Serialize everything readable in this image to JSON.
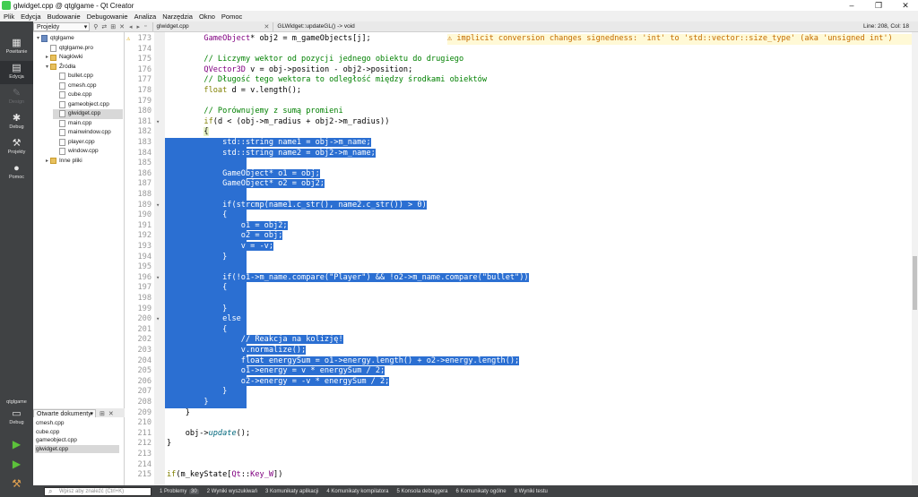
{
  "window": {
    "title": "glwidget.cpp @ qtglgame - Qt Creator",
    "minimize": "–",
    "maximize": "❐",
    "close": "✕"
  },
  "menu": [
    "Plik",
    "Edycja",
    "Budowanie",
    "Debugowanie",
    "Analiza",
    "Narzędzia",
    "Okno",
    "Pomoc"
  ],
  "modes": [
    {
      "label": "Powitanie",
      "icon": "grid-icon"
    },
    {
      "label": "Edycja",
      "icon": "edit-icon"
    },
    {
      "label": "Design",
      "icon": "design-icon"
    },
    {
      "label": "Debug",
      "icon": "bug-icon"
    },
    {
      "label": "Projekty",
      "icon": "wrench-icon"
    },
    {
      "label": "Pomoc",
      "icon": "help-icon"
    }
  ],
  "kit": {
    "project": "qtglgame",
    "config": "Debug"
  },
  "project_pane": {
    "combo": "Projekty",
    "tree": [
      {
        "label": "qtglgame",
        "depth": 0,
        "arrow": "▾",
        "kind": "proj"
      },
      {
        "label": "qtglgame.pro",
        "depth": 1,
        "arrow": "",
        "kind": "file"
      },
      {
        "label": "Nagłówki",
        "depth": 1,
        "arrow": "▸",
        "kind": "folder"
      },
      {
        "label": "Źródła",
        "depth": 1,
        "arrow": "▾",
        "kind": "folder"
      },
      {
        "label": "bullet.cpp",
        "depth": 2,
        "arrow": "",
        "kind": "file"
      },
      {
        "label": "cmesh.cpp",
        "depth": 2,
        "arrow": "",
        "kind": "file"
      },
      {
        "label": "cube.cpp",
        "depth": 2,
        "arrow": "",
        "kind": "file"
      },
      {
        "label": "gameobject.cpp",
        "depth": 2,
        "arrow": "",
        "kind": "file"
      },
      {
        "label": "glwidget.cpp",
        "depth": 2,
        "arrow": "",
        "kind": "file",
        "selected": true
      },
      {
        "label": "main.cpp",
        "depth": 2,
        "arrow": "",
        "kind": "file"
      },
      {
        "label": "mainwindow.cpp",
        "depth": 2,
        "arrow": "",
        "kind": "file"
      },
      {
        "label": "player.cpp",
        "depth": 2,
        "arrow": "",
        "kind": "file"
      },
      {
        "label": "window.cpp",
        "depth": 2,
        "arrow": "",
        "kind": "file"
      },
      {
        "label": "Inne pliki",
        "depth": 1,
        "arrow": "▸",
        "kind": "folder"
      }
    ]
  },
  "open_docs": {
    "combo": "Otwarte dokumenty",
    "items": [
      "cmesh.cpp",
      "cube.cpp",
      "gameobject.cpp",
      "glwidget.cpp"
    ],
    "selected_index": 3
  },
  "editor_toolbar": {
    "file": "glwidget.cpp",
    "symbol": "GLWidget::updateGL() -> void",
    "position": "Line: 208, Col: 18"
  },
  "editor": {
    "warning": "⚠ implicit conversion changes signedness: 'int' to 'std::vector::size_type' (aka 'unsigned int')"
  },
  "status": {
    "search_placeholder": "Wpisz aby znaleźć (Ctrl+K)",
    "tabs": [
      {
        "num": "1",
        "label": "Problemy",
        "badge": "30"
      },
      {
        "num": "2",
        "label": "Wyniki wyszukiwań",
        "badge": ""
      },
      {
        "num": "3",
        "label": "Komunikaty aplikacji",
        "badge": ""
      },
      {
        "num": "4",
        "label": "Komunikaty kompilatora",
        "badge": ""
      },
      {
        "num": "5",
        "label": "Konsola debuggera",
        "badge": ""
      },
      {
        "num": "6",
        "label": "Komunikaty ogólne",
        "badge": ""
      },
      {
        "num": "8",
        "label": "Wyniki testu",
        "badge": ""
      }
    ]
  }
}
